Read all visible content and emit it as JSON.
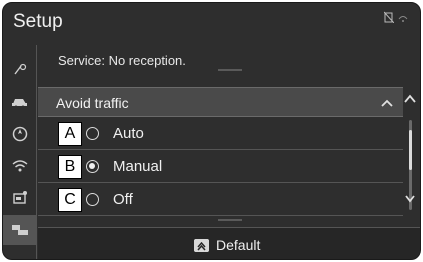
{
  "window": {
    "title": "Setup"
  },
  "notice": "Service: No reception.",
  "section": {
    "title": "Avoid traffic",
    "expanded": true
  },
  "options": [
    {
      "callout": "A",
      "label": "Auto",
      "selected": false
    },
    {
      "callout": "B",
      "label": "Manual",
      "selected": true
    },
    {
      "callout": "C",
      "label": "Off",
      "selected": false
    }
  ],
  "footer": {
    "default_label": "Default"
  },
  "sidebar": {
    "items": [
      {
        "icon": "nav-settings-icon"
      },
      {
        "icon": "vehicle-icon"
      },
      {
        "icon": "compass-icon"
      },
      {
        "icon": "wifi-icon"
      },
      {
        "icon": "display-settings-icon"
      },
      {
        "icon": "traffic-icon",
        "active": true
      }
    ]
  },
  "status": {
    "icons": [
      "no-signal-icon",
      "network-icon"
    ]
  },
  "colors": {
    "background": "#2e2e2e",
    "header": "#4a4a4a",
    "text": "#f0f0f0"
  }
}
